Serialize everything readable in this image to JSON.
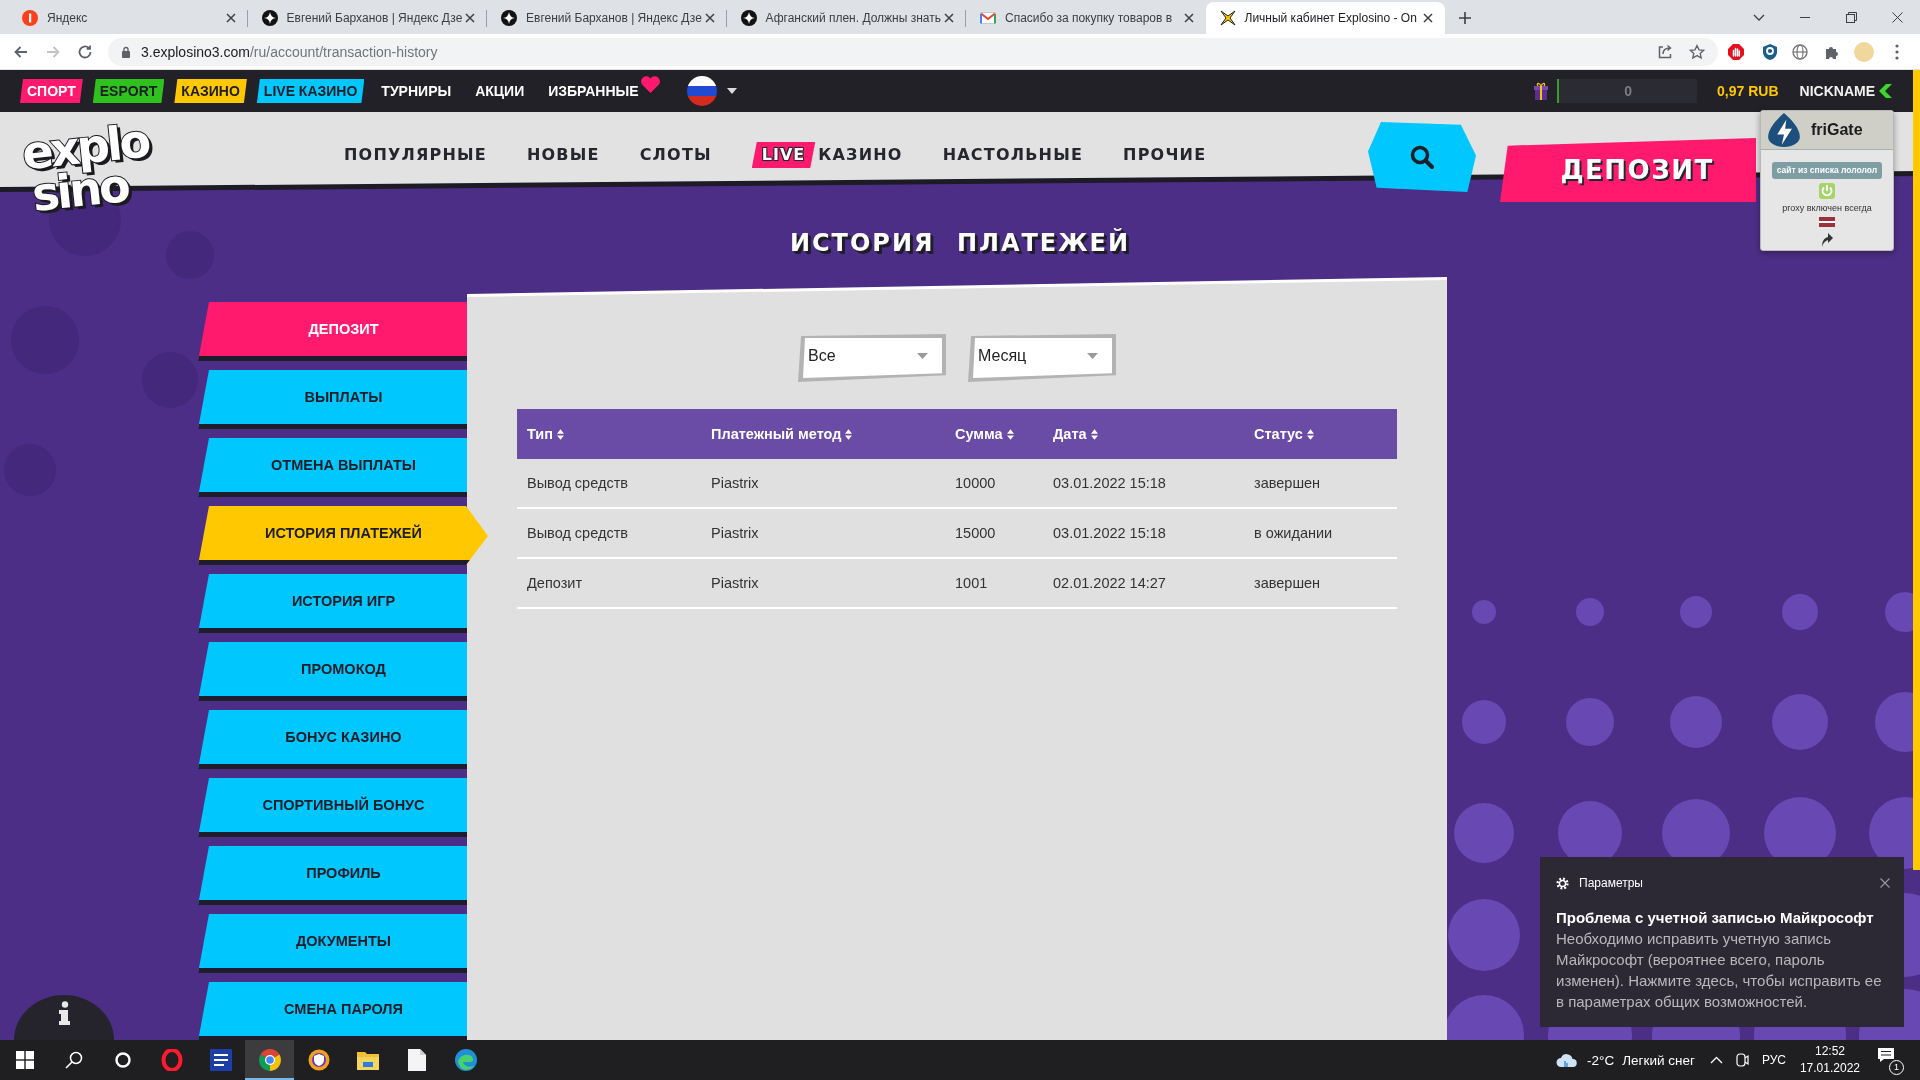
{
  "browser": {
    "tabs": [
      {
        "kind": "portal",
        "title": "Яндекс",
        "selected": false
      },
      {
        "kind": "blog",
        "title": "Евгений Барханов | Яндекс Дзе",
        "selected": false
      },
      {
        "kind": "blog",
        "title": "Евгений Барханов | Яндекс Дзе",
        "selected": false
      },
      {
        "kind": "blog",
        "title": "Афганский плен. Должны знать",
        "selected": false
      },
      {
        "kind": "mail",
        "title": "Спасибо за покупку товаров в",
        "selected": false
      },
      {
        "kind": "site",
        "title": "Личный кабинет Explosino - On",
        "selected": true
      }
    ],
    "nav_buttons": [
      {
        "kind": "back",
        "disabled": false
      },
      {
        "kind": "forward",
        "disabled": true
      },
      {
        "kind": "reload",
        "disabled": false
      }
    ],
    "address": {
      "host": "3.explosino3.com",
      "path": "/ru/account/transaction-history"
    }
  },
  "top_nav": {
    "items": [
      {
        "label": "СПОРТ",
        "color": "#ff1a6e"
      },
      {
        "label": "ESPORT",
        "color": "#2fc21f"
      },
      {
        "label": "КАЗИНО",
        "color": "#ffc800"
      },
      {
        "label": "LIVE КАЗИНО",
        "color": "#00c8ff"
      },
      {
        "label": "ТУРНИРЫ"
      },
      {
        "label": "АКЦИИ"
      },
      {
        "label": "ИЗБРАННЫЕ"
      }
    ],
    "points": "0",
    "balance": "0,97 RUB",
    "nickname": "NICKNAME"
  },
  "header": {
    "logo": {
      "line_1": "explo",
      "line_2": "sino"
    },
    "nav": [
      {
        "label": "ПОПУЛЯРНЫЕ"
      },
      {
        "label": "НОВЫЕ"
      },
      {
        "label": "СЛОТЫ"
      },
      {
        "badge": "LIVE",
        "label": "КАЗИНО"
      },
      {
        "label": "НАСТОЛЬНЫЕ"
      },
      {
        "label": "ПРОЧИЕ"
      }
    ],
    "deposit_button": "ДЕПОЗИТ"
  },
  "page_title": "ИСТОРИЯ ПЛАТЕЖЕЙ",
  "sidebar": [
    {
      "label": "ДЕПОЗИТ",
      "kind": "deposit",
      "selected": false
    },
    {
      "label": "ВЫПЛАТЫ",
      "kind": "page",
      "selected": false
    },
    {
      "label": "ОТМЕНА ВЫПЛАТЫ",
      "kind": "page",
      "selected": false
    },
    {
      "label": "ИСТОРИЯ ПЛАТЕЖЕЙ",
      "kind": "page",
      "selected": true
    },
    {
      "label": "ИСТОРИЯ ИГР",
      "kind": "page",
      "selected": false
    },
    {
      "label": "ПРОМОКОД",
      "kind": "page",
      "selected": false
    },
    {
      "label": "БОНУС КАЗИНО",
      "kind": "page",
      "selected": false
    },
    {
      "label": "СПОРТИВНЫЙ БОНУС",
      "kind": "page",
      "selected": false
    },
    {
      "label": "ПРОФИЛЬ",
      "kind": "page",
      "selected": false
    },
    {
      "label": "ДОКУМЕНТЫ",
      "kind": "page",
      "selected": false
    },
    {
      "label": "СМЕНА ПАРОЛЯ",
      "kind": "page",
      "selected": false
    }
  ],
  "filters": [
    {
      "value": "Все"
    },
    {
      "value": "Месяц"
    }
  ],
  "table": {
    "columns": [
      "Тип",
      "Платежный метод",
      "Сумма",
      "Дата",
      "Статус"
    ],
    "rows": [
      [
        "Вывод средств",
        "Piastrix",
        "10000",
        "03.01.2022 15:18",
        "завершен"
      ],
      [
        "Вывод средств",
        "Piastrix",
        "15000",
        "03.01.2022 15:18",
        "в ожидании"
      ],
      [
        "Депозит",
        "Piastrix",
        "1001",
        "02.01.2022 14:27",
        "завершен"
      ]
    ]
  },
  "extension_popup": {
    "title": "friGate",
    "status": "сайт из списка лололол",
    "note": "proxy включен всегда"
  },
  "notification": {
    "app": "Параметры",
    "title": "Проблема с учетной записью Майкрософт",
    "body": "Необходимо исправить учетную запись Майкрософт (вероятнее всего, пароль изменен). Нажмите здесь, чтобы исправить ее в параметрах общих возможностей."
  },
  "taskbar": {
    "apps": [
      {
        "kind": "opera",
        "selected": false
      },
      {
        "kind": "word",
        "selected": false
      },
      {
        "kind": "chrome",
        "selected": true
      },
      {
        "kind": "secure",
        "selected": false
      },
      {
        "kind": "explorer",
        "selected": false
      },
      {
        "kind": "notepad",
        "selected": false
      },
      {
        "kind": "edge",
        "selected": false
      }
    ],
    "temperature": "-2°C",
    "weather": "Легкий снег",
    "language": "РУС",
    "time": "12:52",
    "date": "17.01.2022",
    "notifications": "1"
  }
}
